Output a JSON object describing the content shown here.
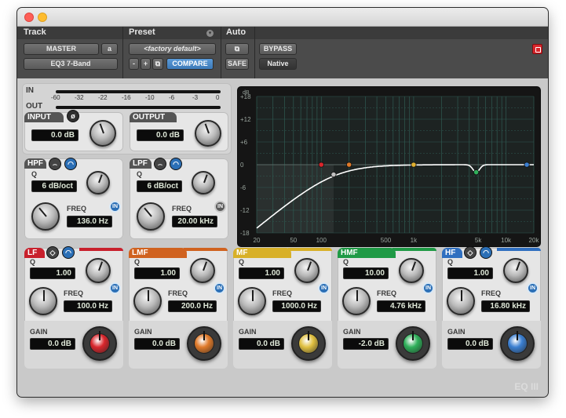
{
  "header": {
    "track_label": "Track",
    "preset_label": "Preset",
    "auto_label": "Auto",
    "track_name": "MASTER",
    "track_slot": "a",
    "insert_name": "EQ3 7-Band",
    "preset_name": "<factory default>",
    "minus_label": "-",
    "plus_label": "+",
    "compare_label": "COMPARE",
    "safe_label": "SAFE",
    "bypass_label": "BYPASS",
    "native_label": "Native"
  },
  "meters": {
    "in_label": "IN",
    "out_label": "OUT",
    "scale": [
      "-60",
      "-32",
      "-22",
      "-16",
      "-10",
      "-6",
      "-3",
      "0"
    ]
  },
  "input": {
    "label": "INPUT",
    "value": "0.0 dB"
  },
  "output": {
    "label": "OUTPUT",
    "value": "0.0 dB"
  },
  "hpf": {
    "label": "HPF",
    "q_label": "Q",
    "q_value": "6 dB/oct",
    "freq_label": "FREQ",
    "freq_value": "136.0 Hz",
    "in_label": "IN"
  },
  "lpf": {
    "label": "LPF",
    "q_label": "Q",
    "q_value": "6 dB/oct",
    "freq_label": "FREQ",
    "freq_value": "20.00 kHz",
    "in_label": "IN"
  },
  "graph": {
    "y_unit": "dB",
    "y_ticks": [
      "+18",
      "+12",
      "+6",
      "0",
      "-6",
      "-12",
      "-18"
    ],
    "x_ticks": [
      "20",
      "50",
      "100",
      "500",
      "1k",
      "5k",
      "10k",
      "20k"
    ],
    "y_range": [
      -18,
      18
    ],
    "x_range_hz": [
      20,
      20000
    ],
    "x_scale": "log",
    "curve_color": "#ffffff",
    "band_points": [
      {
        "band": "LF",
        "freq_hz": 100,
        "gain_db": 0,
        "color": "#d9262c"
      },
      {
        "band": "LMF",
        "freq_hz": 200,
        "gain_db": 0,
        "color": "#e07a2a"
      },
      {
        "band": "HPF",
        "freq_hz": 136,
        "gain_db": -2.6,
        "color": "#bfbfbf"
      },
      {
        "band": "MF",
        "freq_hz": 1000,
        "gain_db": 0,
        "color": "#e0b030"
      },
      {
        "band": "HMF",
        "freq_hz": 4760,
        "gain_db": -2,
        "color": "#2fb05a"
      },
      {
        "band": "HF",
        "freq_hz": 16800,
        "gain_db": 0,
        "color": "#3b7fd1"
      }
    ]
  },
  "bands": [
    {
      "id": "lf",
      "label": "LF",
      "color": "#c8202c",
      "cap": "#d9262c",
      "q_label": "Q",
      "q_value": "1.00",
      "freq_label": "FREQ",
      "freq_value": "100.0 Hz",
      "gain_label": "GAIN",
      "gain_value": "0.0 dB",
      "in_label": "IN"
    },
    {
      "id": "lmf",
      "label": "LMF",
      "color": "#d0621f",
      "cap": "#e07a2a",
      "q_label": "Q",
      "q_value": "1.00",
      "freq_label": "FREQ",
      "freq_value": "200.0 Hz",
      "gain_label": "GAIN",
      "gain_value": "0.0 dB",
      "in_label": "IN"
    },
    {
      "id": "mf",
      "label": "MF",
      "color": "#d8b028",
      "cap": "#e0c040",
      "q_label": "Q",
      "q_value": "1.00",
      "freq_label": "FREQ",
      "freq_value": "1000.0 Hz",
      "gain_label": "GAIN",
      "gain_value": "0.0 dB",
      "in_label": "IN"
    },
    {
      "id": "hmf",
      "label": "HMF",
      "color": "#1f9a45",
      "cap": "#2fb05a",
      "q_label": "Q",
      "q_value": "10.00",
      "freq_label": "FREQ",
      "freq_value": "4.76 kHz",
      "gain_label": "GAIN",
      "gain_value": "-2.0 dB",
      "in_label": "IN"
    },
    {
      "id": "hf",
      "label": "HF",
      "color": "#2f6fc0",
      "cap": "#3b7fd1",
      "q_label": "Q",
      "q_value": "1.00",
      "freq_label": "FREQ",
      "freq_value": "16.80 kHz",
      "gain_label": "GAIN",
      "gain_value": "0.0 dB",
      "in_label": "IN"
    }
  ],
  "footer": {
    "logo": "EQ III"
  }
}
